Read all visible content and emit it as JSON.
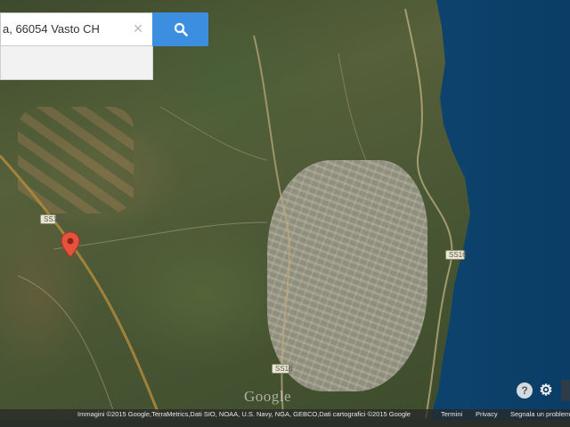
{
  "search": {
    "query": "a, 66054 Vasto CH",
    "clear_icon": "close-icon",
    "search_icon": "search-icon"
  },
  "map": {
    "type": "satellite",
    "road_shields": [
      "SS16",
      "SS16",
      "SS16"
    ],
    "logo": "Google",
    "marker_icon": "map-pin-icon",
    "marker_color": "#e5533f",
    "sea_color": "#0f5d8a"
  },
  "controls": {
    "help_label": "?",
    "settings_icon": "gear-icon"
  },
  "attribution": {
    "copyright": "Immagini ©2015 Google,TerraMetrics,Dati SIO, NOAA, U.S. Navy, NGA, GEBCO,Dati cartografici ©2015 Google",
    "terms": "Termini",
    "privacy": "Privacy",
    "report": "Segnala un problema"
  }
}
